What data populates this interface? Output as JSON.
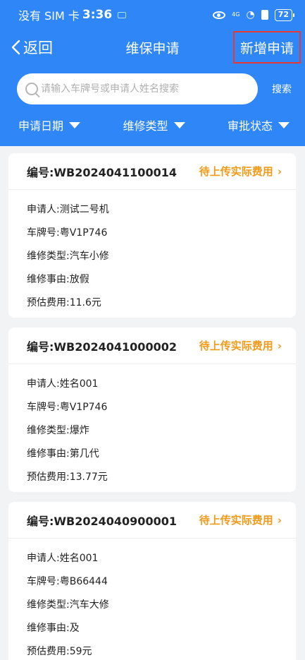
{
  "status_bar": {
    "carrier": "没有 SIM 卡",
    "time": "3:36",
    "network": "4G",
    "battery": "72"
  },
  "nav": {
    "back_label": "返回",
    "title": "维保申请",
    "add_label": "新增申请"
  },
  "search": {
    "placeholder": "请输入车牌号或申请人姓名搜索",
    "button_label": "搜索"
  },
  "filters": [
    {
      "label": "申请日期"
    },
    {
      "label": "维修类型"
    },
    {
      "label": "审批状态"
    }
  ],
  "colors": {
    "primary": "#2f86f6",
    "status_orange": "#f09a1a",
    "highlight_red": "#e53935"
  },
  "icons": [
    "back-chevron-icon",
    "search-icon",
    "dropdown-triangle-icon",
    "chevron-right-icon",
    "eye-icon",
    "wifi-icon",
    "battery-icon"
  ],
  "records": [
    {
      "number": "编号:WB2024041100014",
      "status": "待上传实际费用",
      "applicant": "申请人:测试二号机",
      "plate": "车牌号:粤V1P746",
      "type": "维修类型:汽车小修",
      "reason": "维修事由:放假",
      "cost": "预估费用:11.6元"
    },
    {
      "number": "编号:WB2024041000002",
      "status": "待上传实际费用",
      "applicant": "申请人:姓名001",
      "plate": "车牌号:粤V1P746",
      "type": "维修类型:爆炸",
      "reason": "维修事由:第几代",
      "cost": "预估费用:13.77元"
    },
    {
      "number": "编号:WB2024040900001",
      "status": "待上传实际费用",
      "applicant": "申请人:姓名001",
      "plate": "车牌号:粤B66444",
      "type": "维修类型:汽车大修",
      "reason": "维修事由:及",
      "cost": "预估费用:59元"
    }
  ]
}
